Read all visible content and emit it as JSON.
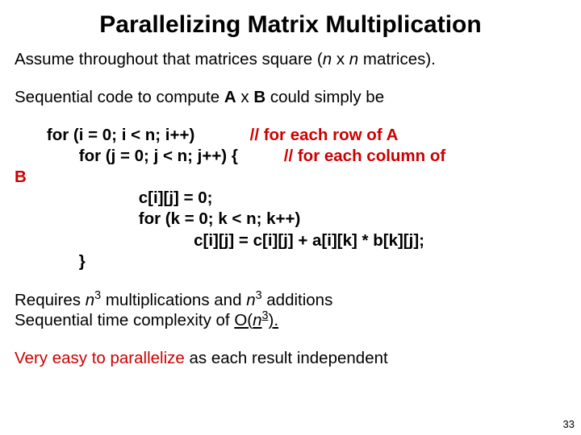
{
  "title": "Parallelizing Matrix Multiplication",
  "intro_pre": "Assume throughout that matrices square (",
  "intro_n1": "n",
  "intro_mid": " x ",
  "intro_n2": "n",
  "intro_post": " matrices).",
  "seq_pre": "Sequential code to compute ",
  "seq_A": "A",
  "seq_x": " x ",
  "seq_B": "B",
  "seq_post": " could simply be",
  "code": {
    "l1_a": "       for (i = 0; i < n; i++)            ",
    "l1_b": "// for each row of A",
    "l2_a": "              for (j = 0; j < n; j++) {          ",
    "l2_b": "// for each column of",
    "l3": "B",
    "l4": "                           c[i][j] = 0;",
    "l5": "                           for (k = 0; k < n; k++)",
    "l6": "                                       c[i][j] = c[i][j] + a[i][k] * b[k][j];",
    "l7": "              }"
  },
  "req_pre": "Requires ",
  "req_n1": "n",
  "req_exp1": "3",
  "req_mid": " multiplications and ",
  "req_n2": "n",
  "req_exp2": "3",
  "req_post": " additions",
  "complexity_pre": "Sequential time complexity of ",
  "complexity_O": "O(",
  "complexity_n": "n",
  "complexity_exp": "3",
  "complexity_close": ").",
  "easy_red": "Very easy to parallelize",
  "easy_post": " as each result independent",
  "pagenum": "33"
}
